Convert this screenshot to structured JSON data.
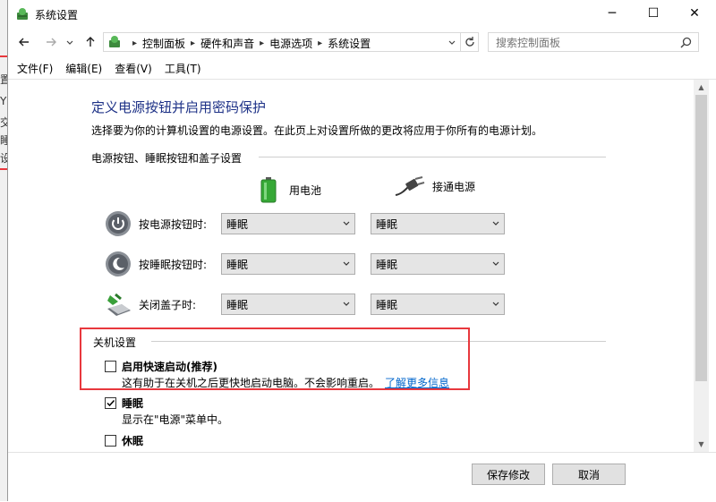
{
  "window": {
    "title": "系统设置",
    "controls": {
      "minimize": "─",
      "maximize": "☐",
      "close": "✕"
    }
  },
  "address": {
    "breadcrumbs": [
      "控制面板",
      "硬件和声音",
      "电源选项",
      "系统设置"
    ],
    "search_placeholder": "搜索控制面板"
  },
  "menu": [
    "文件(F)",
    "编辑(E)",
    "查看(V)",
    "工具(T)"
  ],
  "background_window": {
    "text_fragments": [
      "置",
      "Y",
      "交",
      "睡",
      "设"
    ]
  },
  "main": {
    "heading": "定义电源按钮并启用密码保护",
    "description": "选择要为你的计算机设置的电源设置。在此页上对设置所做的更改将应用于你所有的电源计划。",
    "buttons_section_label": "电源按钮、睡眠按钮和盖子设置",
    "columns": {
      "battery": "用电池",
      "plugged": "接通电源"
    },
    "rows": [
      {
        "label": "按电源按钮时:",
        "battery": "睡眠",
        "plugged": "睡眠"
      },
      {
        "label": "按睡眠按钮时:",
        "battery": "睡眠",
        "plugged": "睡眠"
      },
      {
        "label": "关闭盖子时:",
        "battery": "睡眠",
        "plugged": "睡眠"
      }
    ],
    "shutdown_section_label": "关机设置",
    "fast_startup": {
      "label": "启用快速启动(推荐)",
      "checked": false,
      "description": "这有助于在关机之后更快地启动电脑。不会影响重启。",
      "link": "了解更多信息"
    },
    "sleep": {
      "label": "睡眠",
      "checked": true,
      "description": "显示在\"电源\"菜单中。"
    },
    "hibernate": {
      "label": "休眠",
      "checked": false
    }
  },
  "footer": {
    "save": "保存修改",
    "cancel": "取消"
  },
  "colors": {
    "heading": "#1e3287",
    "link": "#0066cc",
    "highlight_box": "#e8383d"
  }
}
